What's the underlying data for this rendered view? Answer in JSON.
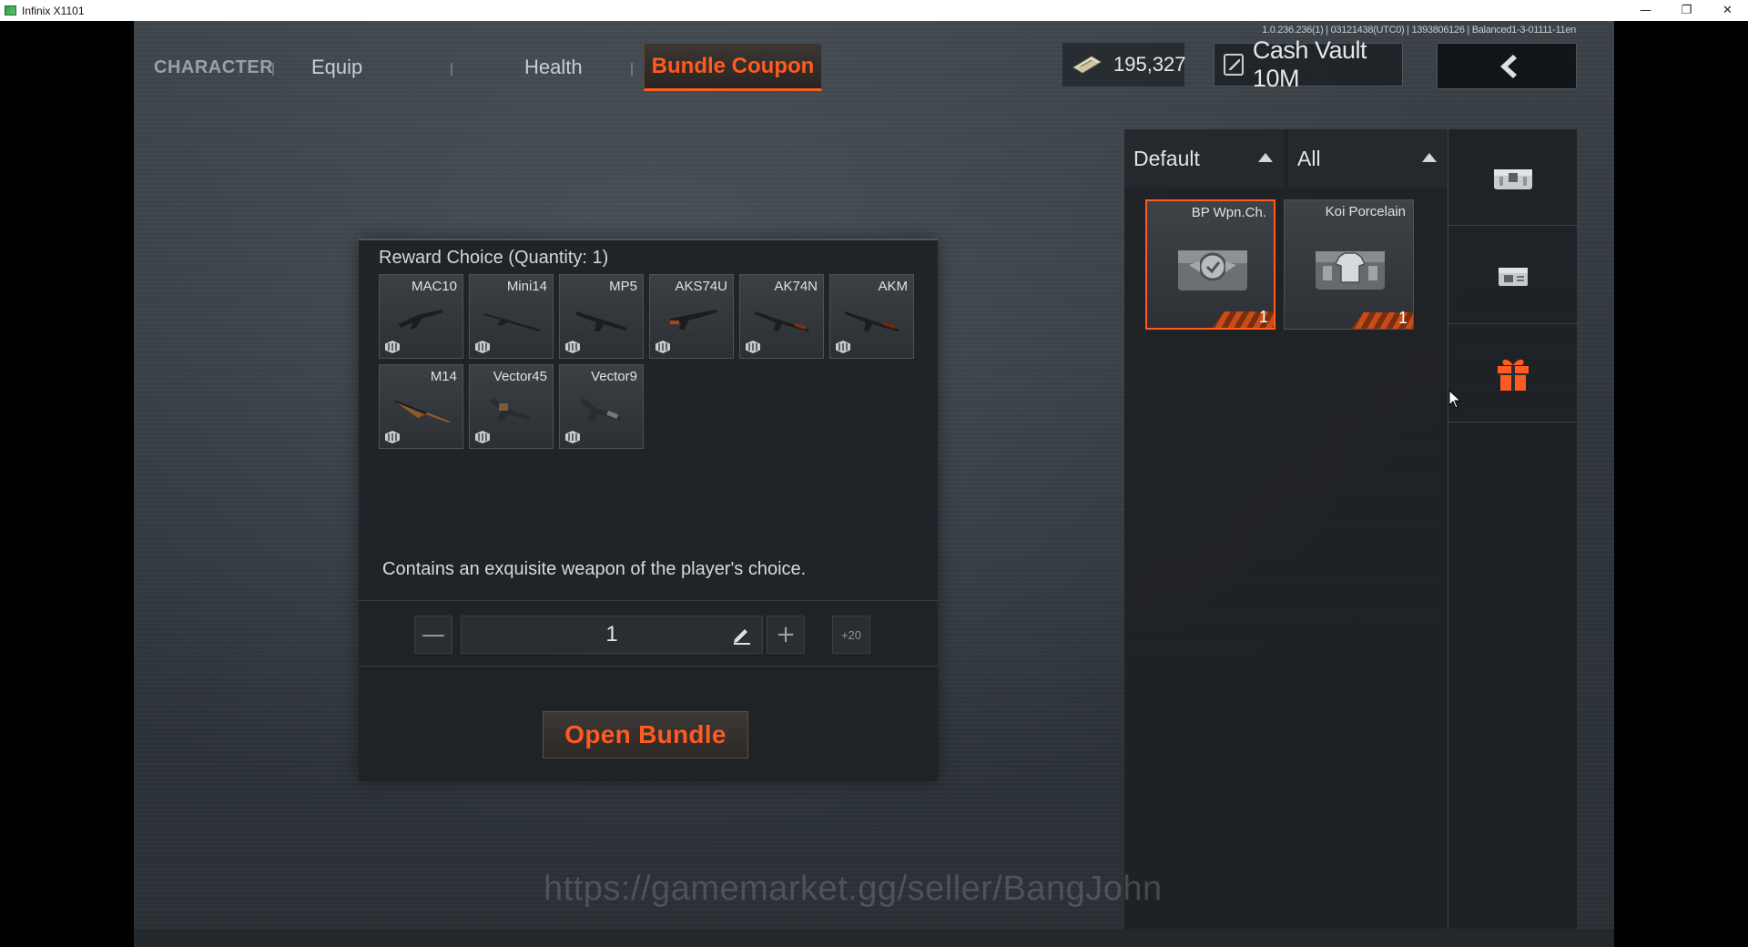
{
  "window": {
    "title": "Infinix X1101",
    "min_glyph": "—",
    "restore_glyph": "❐",
    "close_glyph": "✕"
  },
  "game": {
    "version": "1.0.236.236(1) | 03121438(UTC0) | 1393806126 | Balanced1-3-01111-11en",
    "tabs": {
      "character": "CHARACTER",
      "equip": "Equip",
      "health": "Health",
      "bundle_coupon": "Bundle Coupon"
    },
    "currency": {
      "amount": "195,327",
      "vault_label": "Cash Vault 10M"
    },
    "dialog": {
      "title": "Reward Choice (Quantity: 1)",
      "weapons": [
        {
          "name": "MAC10"
        },
        {
          "name": "Mini14"
        },
        {
          "name": "MP5"
        },
        {
          "name": "AKS74U"
        },
        {
          "name": "AK74N"
        },
        {
          "name": "AKM"
        },
        {
          "name": "M14"
        },
        {
          "name": "Vector45"
        },
        {
          "name": "Vector9"
        }
      ],
      "description": "Contains an exquisite weapon of the player's choice.",
      "quantity": {
        "minus_label": "—",
        "value": "1",
        "plus_label": "+",
        "plus20_label": "+20"
      },
      "open_button": "Open Bundle"
    },
    "inventory": {
      "sort_dropdown": "Default",
      "filter_dropdown": "All",
      "items": [
        {
          "name": "BP Wpn.Ch.",
          "count": "1",
          "selected": true
        },
        {
          "name": "Koi Porcelain",
          "count": "1",
          "selected": false
        }
      ]
    },
    "side_icons": [
      "bundle-chest-icon",
      "coupon-box-icon",
      "gift-icon"
    ],
    "accent_color": "#ff5a1f",
    "watermark": "https://gamemarket.gg/seller/BangJohn"
  }
}
